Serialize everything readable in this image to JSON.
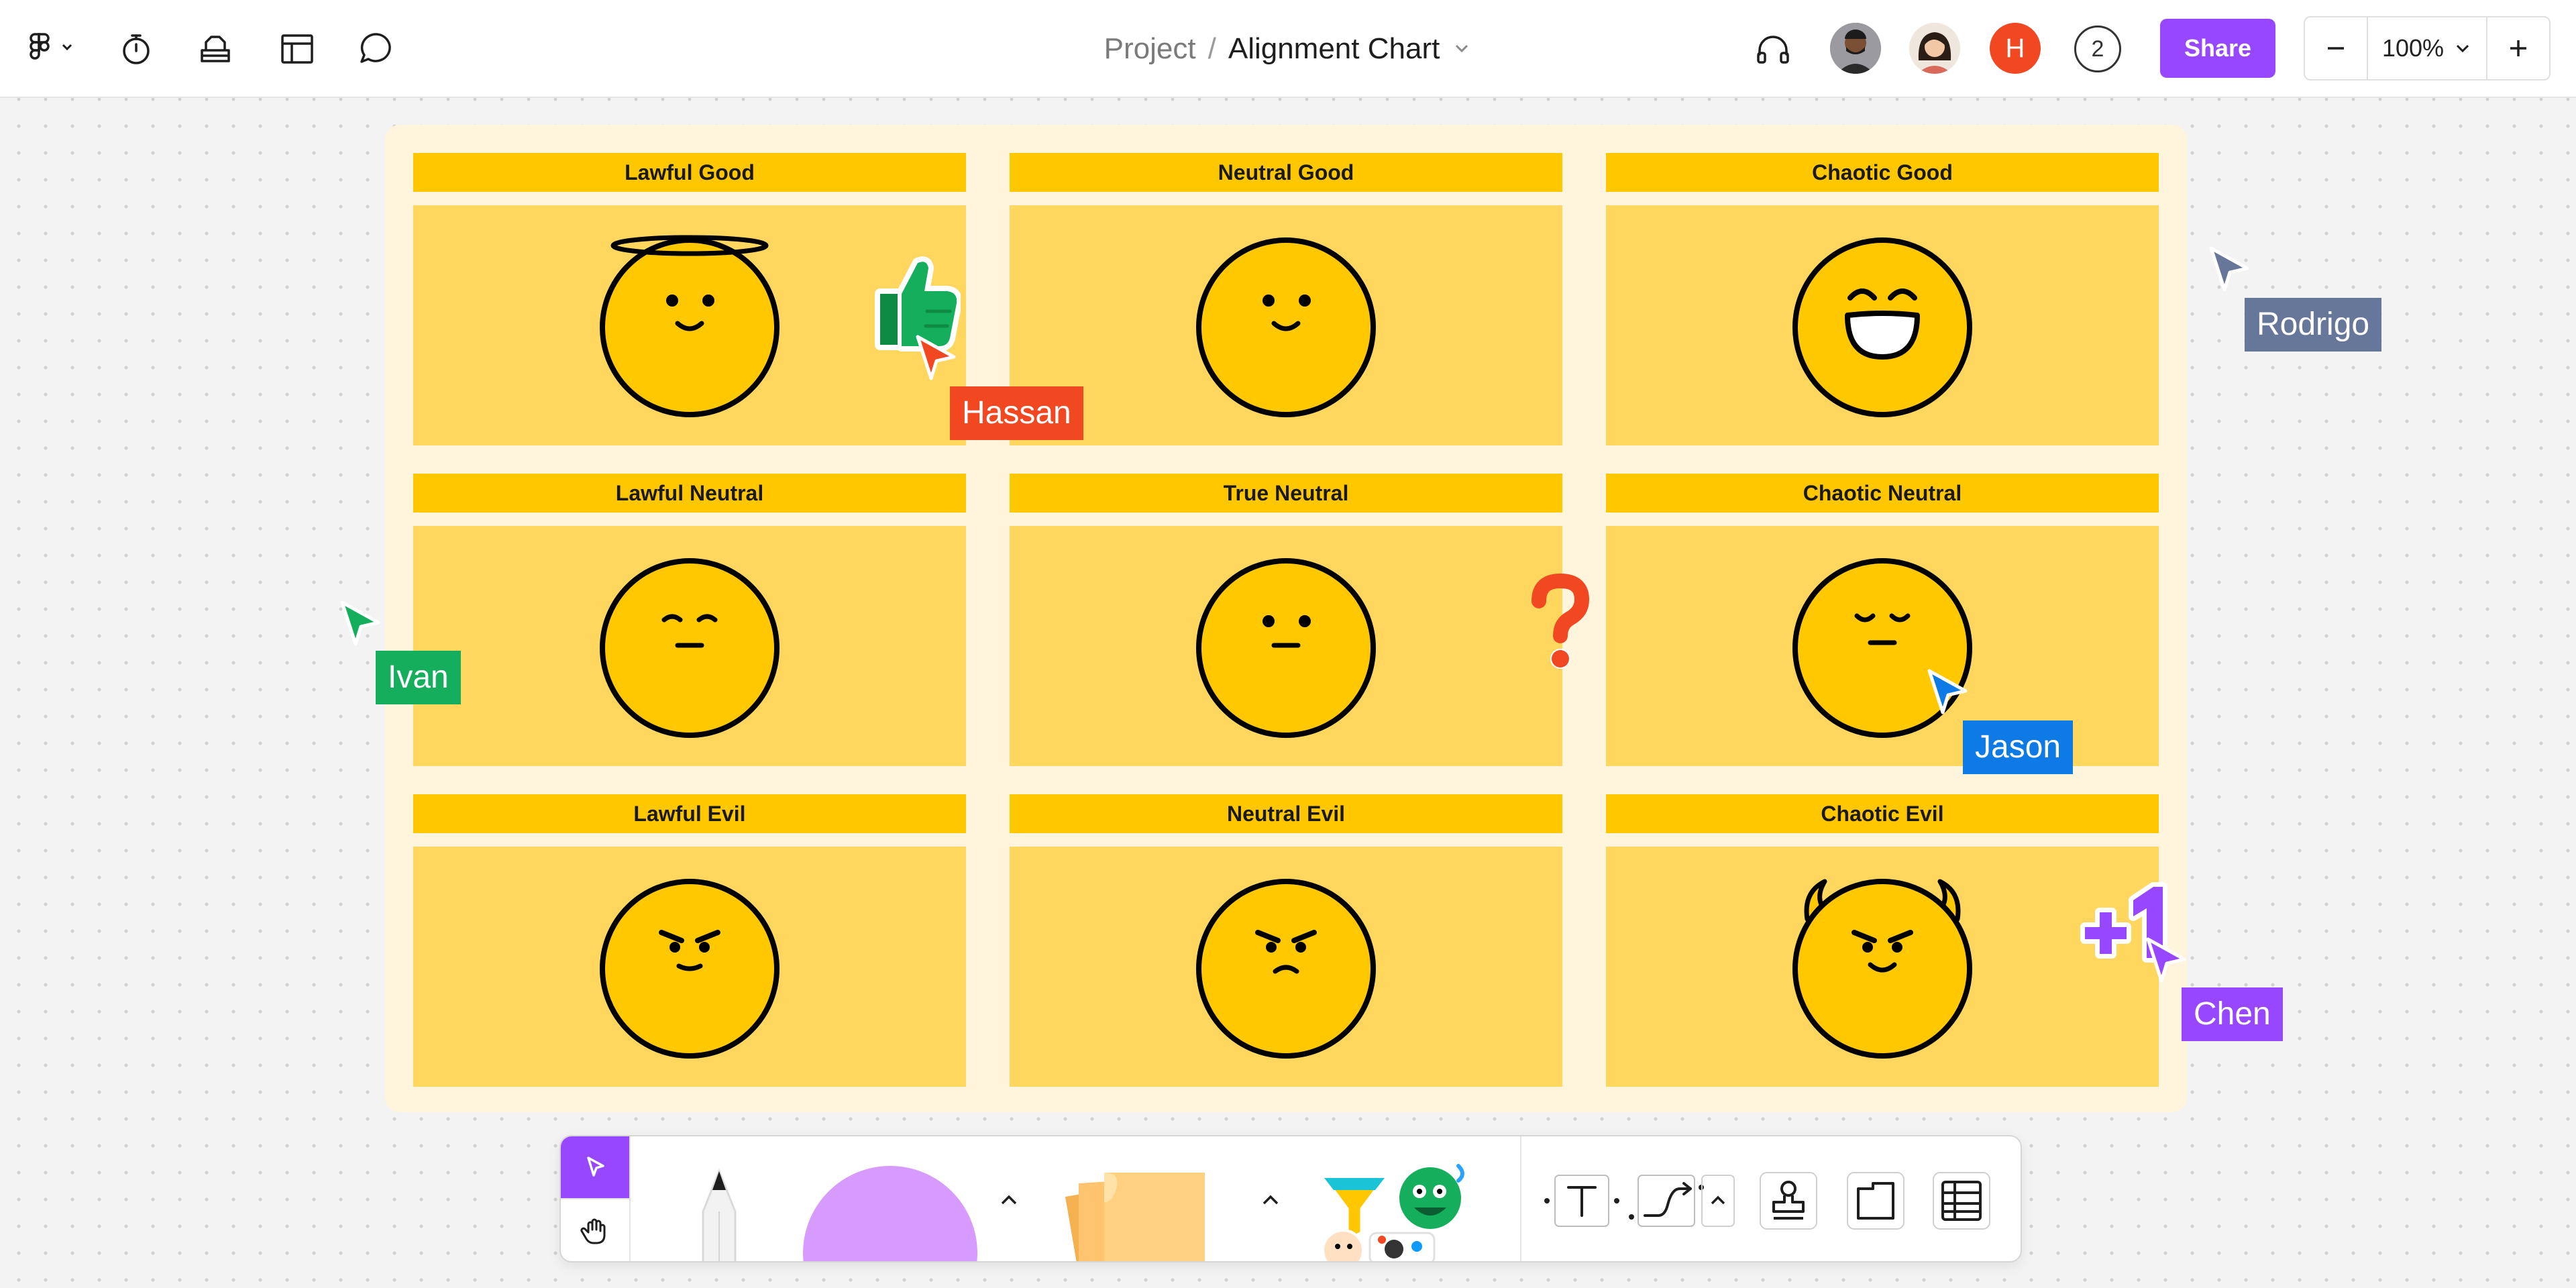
{
  "topbar": {
    "breadcrumb_project": "Project",
    "breadcrumb_separator": "/",
    "file_title": "Alignment Chart",
    "avatar_initial": "H",
    "collaborator_count": "2",
    "share_label": "Share",
    "zoom_level": "100%",
    "icons": [
      "figma-logo-icon",
      "timer-icon",
      "stamp-tray-icon",
      "layout-icon",
      "comment-icon",
      "headphones-icon"
    ]
  },
  "chart": {
    "cells": [
      {
        "title": "Lawful Good",
        "face": "halo"
      },
      {
        "title": "Neutral Good",
        "face": "smile"
      },
      {
        "title": "Chaotic Good",
        "face": "grin"
      },
      {
        "title": "Lawful Neutral",
        "face": "content"
      },
      {
        "title": "True Neutral",
        "face": "neutral"
      },
      {
        "title": "Chaotic Neutral",
        "face": "sleepy"
      },
      {
        "title": "Lawful Evil",
        "face": "angry"
      },
      {
        "title": "Neutral Evil",
        "face": "frown"
      },
      {
        "title": "Chaotic Evil",
        "face": "devil"
      }
    ]
  },
  "cursors": [
    {
      "name": "Hassan",
      "color": "#f24822"
    },
    {
      "name": "Rodrigo",
      "color": "#667799"
    },
    {
      "name": "Ivan",
      "color": "#14ae5c"
    },
    {
      "name": "Jason",
      "color": "#0d7ae6"
    },
    {
      "name": "Chen",
      "color": "#9747ff"
    }
  ],
  "stickers": [
    "thumbs-up-sticker",
    "question-mark-sticker",
    "plus-one-sticker"
  ],
  "colors": {
    "accent": "#9747ff",
    "board_background": "#fff5dc",
    "cell_header": "#ffc700",
    "cell_body": "#ffd75e",
    "face_fill": "#ffc800"
  }
}
